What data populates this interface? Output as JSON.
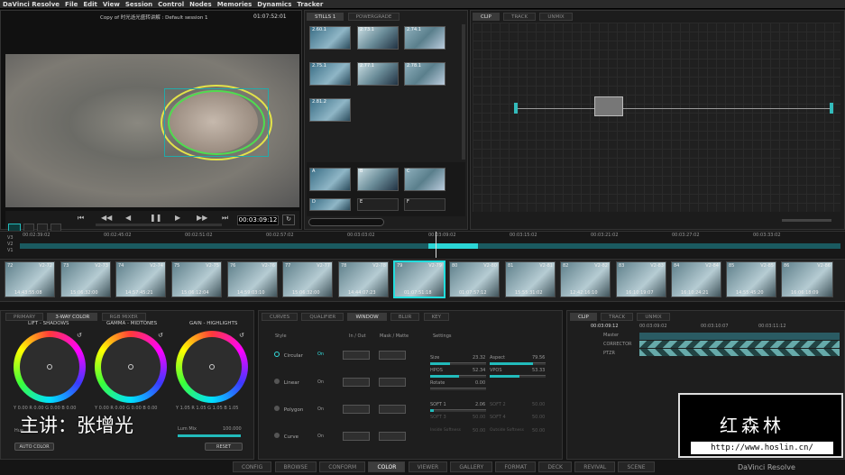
{
  "menu": [
    "DaVinci Resolve",
    "File",
    "Edit",
    "View",
    "Session",
    "Control",
    "Nodes",
    "Memories",
    "Dynamics",
    "Tracker"
  ],
  "viewer": {
    "title": "Copy of 时光逝光盛转讲解 : Default session 1",
    "timecode_top": "01:07:52:01",
    "timecode": "00:03:09:12"
  },
  "stills": {
    "tabs": [
      "STILLS 1",
      "POWERGRADE"
    ],
    "items": [
      "2.60.1",
      "2.73.1",
      "2.74.1",
      "2.75.1",
      "2.77.1",
      "2.78.1",
      "2.81.2"
    ],
    "memory": [
      "A",
      "B",
      "C",
      "D",
      "E",
      "F"
    ]
  },
  "node_tabs": [
    "CLIP",
    "TRACK",
    "UNMIX"
  ],
  "timeline": {
    "ticks": [
      "00:02:39:02",
      "00:02:45:02",
      "00:02:51:02",
      "00:02:57:02",
      "00:03:03:02",
      "00:03:09:02",
      "00:03:15:02",
      "00:03:21:02",
      "00:03:27:02",
      "00:03:33:02"
    ],
    "tracks": [
      "V3",
      "V2",
      "V1"
    ]
  },
  "clips": [
    {
      "num": "72",
      "lbl": "V2-72",
      "tc": "14:43:55:08"
    },
    {
      "num": "73",
      "lbl": "V2-73",
      "tc": "15:06:32:00"
    },
    {
      "num": "74",
      "lbl": "V2-74",
      "tc": "14:57:45:21"
    },
    {
      "num": "75",
      "lbl": "V2-75",
      "tc": "15:06:12:04"
    },
    {
      "num": "76",
      "lbl": "V2-76",
      "tc": "14:59:03:10"
    },
    {
      "num": "77",
      "lbl": "V2-77",
      "tc": "15:06:32:00"
    },
    {
      "num": "78",
      "lbl": "V2-78",
      "tc": "14:44:07:23"
    },
    {
      "num": "79",
      "lbl": "V2-79",
      "tc": "01:07:51:18"
    },
    {
      "num": "80",
      "lbl": "V2-80",
      "tc": "01:07:57:12"
    },
    {
      "num": "81",
      "lbl": "V2-81",
      "tc": "15:55:31:02"
    },
    {
      "num": "82",
      "lbl": "V2-82",
      "tc": "12:42:16:10"
    },
    {
      "num": "83",
      "lbl": "V2-83",
      "tc": "16:10:19:07"
    },
    {
      "num": "84",
      "lbl": "V2-84",
      "tc": "16:10:24:21"
    },
    {
      "num": "85",
      "lbl": "V2-85",
      "tc": "14:55:45:20"
    },
    {
      "num": "86",
      "lbl": "V2-86",
      "tc": "16:06:18:09"
    }
  ],
  "color": {
    "tabs": [
      "PRIMARY",
      "3-WAY COLOR",
      "RGB MIXER"
    ],
    "wheels": [
      {
        "label": "LIFT - SHADOWS",
        "vals": "Y 0.00  R 0.00  G 0.00  B 0.00"
      },
      {
        "label": "GAMMA - MIDTONES",
        "vals": "Y 0.00  R 0.00  G 0.00  B 0.00"
      },
      {
        "label": "GAIN - HIGHLIGHTS",
        "vals": "Y 1.05  R 1.05  G 1.05  B 1.05"
      }
    ],
    "hue": "Hue",
    "lum_mix": "Lum Mix",
    "lum_mix_val": "100.000",
    "auto_color": "AUTO COLOR",
    "reset": "RESET"
  },
  "window": {
    "tabs": [
      "CURVES",
      "QUALIFIER",
      "WINDOW",
      "BLUR",
      "KEY"
    ],
    "headers": {
      "style": "Style",
      "inout": "In / Out",
      "mask": "Mask / Matte",
      "settings": "Settings"
    },
    "shapes": [
      "Circular",
      "Linear",
      "Polygon",
      "Curve"
    ],
    "on": "On",
    "settings": [
      {
        "a": "Size",
        "av": "23.32",
        "b": "Aspect",
        "bv": "79.56"
      },
      {
        "a": "HPOS",
        "av": "52.34",
        "b": "VPOS",
        "bv": "53.33"
      },
      {
        "a": "Rotate",
        "av": "0.00",
        "b": "",
        "bv": ""
      },
      {
        "a": "SOFT 1",
        "av": "2.06",
        "b": "SOFT 2",
        "bv": "50.00"
      },
      {
        "a": "SOFT 3",
        "av": "50.00",
        "b": "SOFT 4",
        "bv": "50.00"
      },
      {
        "a": "Inside Softness",
        "av": "50.00",
        "b": "Outside Softness",
        "bv": "50.00"
      }
    ]
  },
  "keyframe": {
    "tabs": [
      "CLIP",
      "TRACK",
      "UNMIX"
    ],
    "tc": "00:03:09:12",
    "ticks": [
      "00:03:09:02",
      "00:03:10:07",
      "00:03:11:12"
    ],
    "rows": [
      "Master",
      "CORRECTOR",
      "PTZR"
    ]
  },
  "overlay": {
    "lecturer": "主讲：张增光",
    "brand": "红森林",
    "url": "http://www.hoslin.cn/"
  },
  "bottom_tabs": [
    "CONFIG",
    "BROWSE",
    "CONFORM",
    "COLOR",
    "VIEWER",
    "GALLERY",
    "FORMAT",
    "DECK",
    "REVIVAL",
    "SCENE"
  ],
  "logo": "DaVinci Resolve"
}
